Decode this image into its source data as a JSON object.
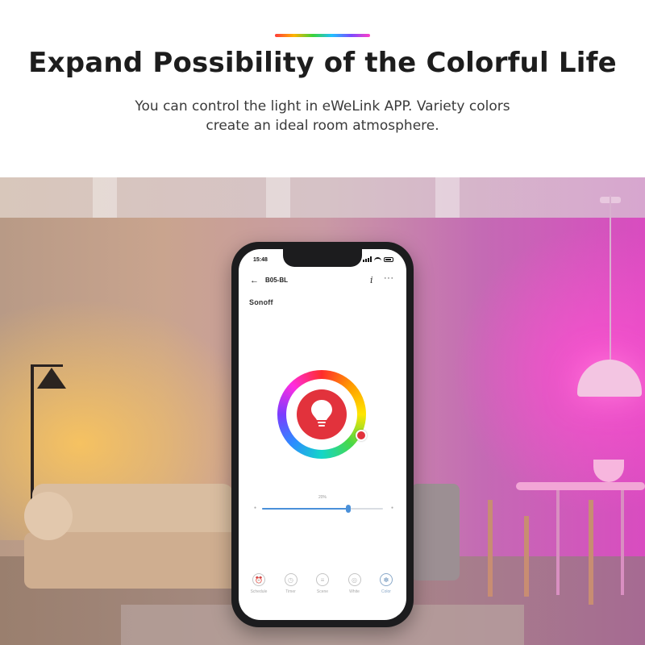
{
  "headline": "Expand Possibility of the Colorful Life",
  "subline": {
    "line1": "You can control the light in eWeLink APP. Variety colors",
    "line2": "create an ideal room atmosphere."
  },
  "colors": {
    "accent_gradient": [
      "#ff3b3b",
      "#ffb400",
      "#3ad33a",
      "#20c0ff",
      "#7a4bff",
      "#ff3ec8"
    ],
    "bulb_red": "#e2323c",
    "slider_blue": "#4a90d9"
  },
  "phone": {
    "status_time": "15:48",
    "device_title": "B05-BL",
    "back_icon": "arrow-left-icon",
    "info_icon": "info-icon",
    "more_icon": "more-icon",
    "brand": "Sonoff",
    "brightness": {
      "label": "20%",
      "min_label": "●",
      "max_label": "●",
      "value_percent": 71
    },
    "tabs": [
      {
        "label": "Schedule",
        "icon": "alarm-clock-icon",
        "glyph": "⏰",
        "active": false
      },
      {
        "label": "Timer",
        "icon": "timer-icon",
        "glyph": "◷",
        "active": false
      },
      {
        "label": "Scene",
        "icon": "scene-icon",
        "glyph": "≡",
        "active": false
      },
      {
        "label": "White",
        "icon": "white-light-icon",
        "glyph": "◎",
        "active": false
      },
      {
        "label": "Color",
        "icon": "color-palette-icon",
        "glyph": "✽",
        "active": true
      }
    ]
  }
}
